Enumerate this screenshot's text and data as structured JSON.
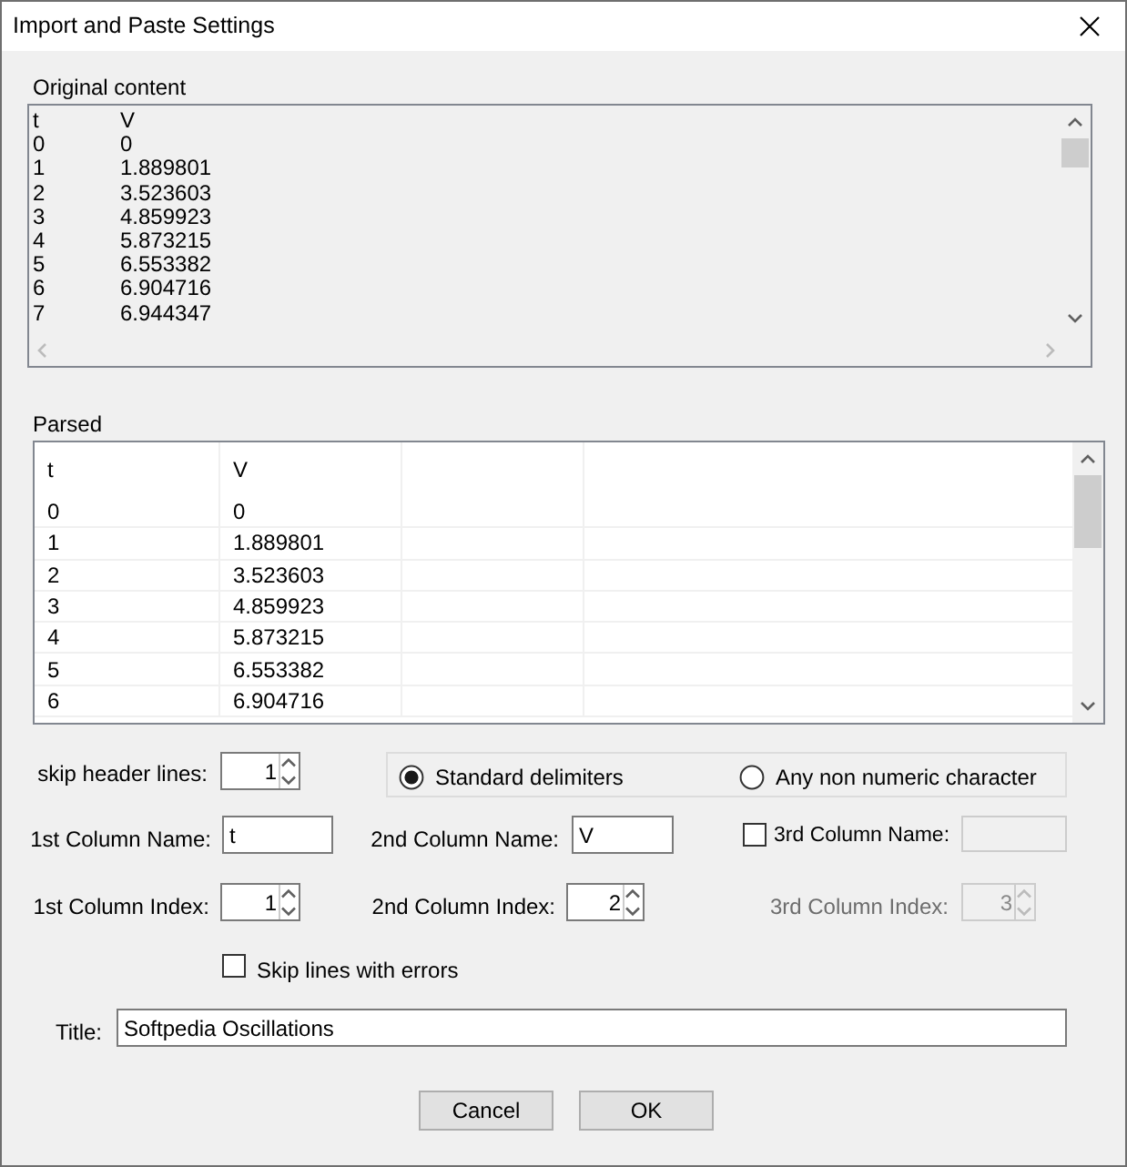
{
  "window": {
    "title": "Import and Paste Settings"
  },
  "original_content": {
    "label": "Original content",
    "lines": [
      [
        "t",
        "V"
      ],
      [
        "0",
        "0"
      ],
      [
        "1",
        "1.889801"
      ],
      [
        "2",
        "3.523603"
      ],
      [
        "3",
        "4.859923"
      ],
      [
        "4",
        "5.873215"
      ],
      [
        "5",
        "6.553382"
      ],
      [
        "6",
        "6.904716"
      ],
      [
        "7",
        "6.944347"
      ]
    ]
  },
  "parsed": {
    "label": "Parsed",
    "columns": [
      "t",
      "V"
    ],
    "rows": [
      [
        "0",
        "0"
      ],
      [
        "1",
        "1.889801"
      ],
      [
        "2",
        "3.523603"
      ],
      [
        "3",
        "4.859923"
      ],
      [
        "4",
        "5.873215"
      ],
      [
        "5",
        "6.553382"
      ],
      [
        "6",
        "6.904716"
      ]
    ]
  },
  "skip_header_lines": {
    "label": "skip header lines:",
    "value": "1"
  },
  "delimiters": [
    {
      "label": "Standard delimiters",
      "selected": true
    },
    {
      "label": "Any non numeric character",
      "selected": false
    }
  ],
  "column_names": [
    {
      "label": "1st Column Name:",
      "value": "t",
      "disabled": false
    },
    {
      "label": "2nd Column Name:",
      "value": "V",
      "disabled": false
    },
    {
      "label": "3rd Column Name:",
      "checked": false,
      "disabled": true
    }
  ],
  "column_indexes": [
    {
      "label": "1st Column Index:",
      "value": "1",
      "disabled": false
    },
    {
      "label": "2nd Column Index:",
      "value": "2",
      "disabled": false
    },
    {
      "label": "3rd Column Index:",
      "value": "3",
      "disabled": true
    }
  ],
  "skip_errors": {
    "label": "Skip lines with errors",
    "checked": false
  },
  "title_field": {
    "label": "Title:",
    "value": "Softpedia Oscillations"
  },
  "buttons": [
    "Cancel",
    "OK"
  ]
}
